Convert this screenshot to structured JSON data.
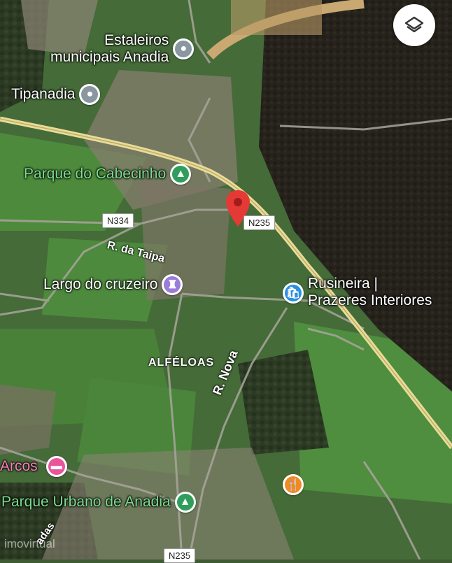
{
  "controls": {
    "layers_icon": "layers-icon"
  },
  "pois": {
    "estaleiros": {
      "label": "Estaleiros\nmunicipais Anadia",
      "icon": "location-icon",
      "color": "#8a96a0"
    },
    "tipanadia": {
      "label": "Tipanadia",
      "icon": "location-icon",
      "color": "#8a96a0"
    },
    "parque_cabecinho": {
      "label": "Parque do Cabecinho",
      "icon": "tree-icon",
      "color": "#2f9e5a"
    },
    "largo_cruzeiro": {
      "label": "Largo do cruzeiro",
      "icon": "monument-icon",
      "color": "#9b7cd8"
    },
    "rusineira": {
      "label": "Rusineira |\nPrazeres Interiores",
      "icon": "shopping-bag-icon",
      "color": "#2d8fe0"
    },
    "arcos": {
      "label": "Arcos",
      "icon": "bed-icon",
      "color": "#e8559b"
    },
    "parque_urbano": {
      "label": "Parque Urbano de Anadia",
      "icon": "tree-icon",
      "color": "#2f9e5a"
    },
    "restaurant": {
      "icon": "fork-knife-icon",
      "color": "#f08a24"
    }
  },
  "pin": {
    "icon": "map-pin-icon",
    "color": "#e53935"
  },
  "roads": {
    "n334": "N334",
    "n235_a": "N235",
    "n235_b": "N235",
    "rua_taipa": "R. da Taipa",
    "rua_nova": "R. Nova",
    "ladas": "adas"
  },
  "places": {
    "alfeloas": "ALFÉLOAS"
  },
  "watermark": "imovirtual"
}
